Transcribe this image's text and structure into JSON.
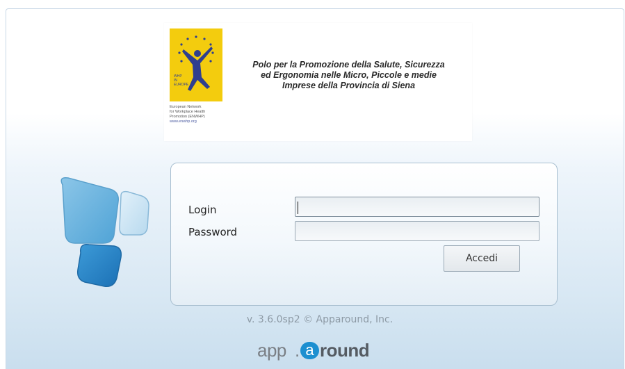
{
  "banner": {
    "title_lines": [
      "Polo per la Promozione della Salute, Sicurezza",
      "ed Ergonomia nelle Micro, Piccole e medie",
      "Imprese della Provincia di Siena"
    ],
    "enwhp_caption_lines": [
      "European Network",
      "for Workplace Health",
      "Promotion (ENWHP)"
    ],
    "enwhp_url": "www.enwhp.org",
    "enwhp_badge_text": "WHP IN EUROPE",
    "brand_yellow": "#f3cc0e"
  },
  "login": {
    "login_label": "Login",
    "password_label": "Password",
    "login_value": "",
    "password_value": "",
    "submit_label": "Accedi"
  },
  "footer": {
    "version": "v. 3.6.0sp2 © Apparound, Inc.",
    "brand_part1": "app",
    "brand_dot": ".",
    "brand_a": "a",
    "brand_part2": "round",
    "brand_accent": "#1c8fd0"
  }
}
